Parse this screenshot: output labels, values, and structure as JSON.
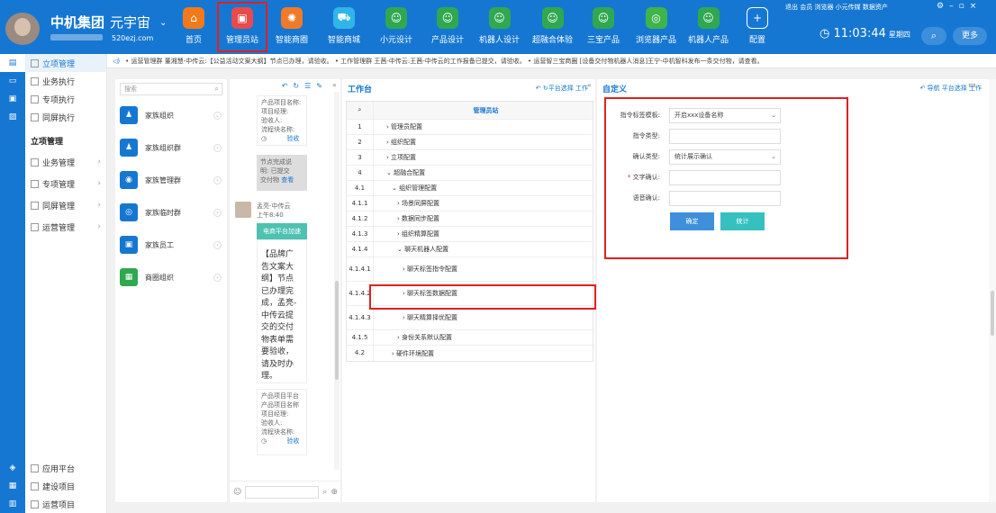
{
  "header": {
    "brand": "中机集团",
    "universe": "元宇宙",
    "url": "520ezj.com",
    "toplinks": "退出  会员  浏览器  小元传媒  数据资产",
    "time": "11:03:44",
    "weekday": "星期四",
    "more": "更多",
    "nav": [
      {
        "label": "首页",
        "icon": "home-icon",
        "color": "#f27a1a"
      },
      {
        "label": "管理员站",
        "icon": "admin-icon",
        "color": "#e84b4b"
      },
      {
        "label": "智能商圈",
        "icon": "gear-icon",
        "color": "#f07a2a"
      },
      {
        "label": "智能商城",
        "icon": "cart-icon",
        "color": "#2fb6e8"
      },
      {
        "label": "小元设计",
        "icon": "robot-icon",
        "color": "#2fa84f"
      },
      {
        "label": "产品设计",
        "icon": "robot-icon",
        "color": "#2fa84f"
      },
      {
        "label": "机器人设计",
        "icon": "robot-icon",
        "color": "#2fa84f"
      },
      {
        "label": "超融合体验",
        "icon": "robot-icon",
        "color": "#2fa84f"
      },
      {
        "label": "三宝产品",
        "icon": "robot-icon",
        "color": "#2fa84f"
      },
      {
        "label": "浏览器产品",
        "icon": "browser-icon",
        "color": "#3fb44a"
      },
      {
        "label": "机器人产品",
        "icon": "robot-icon",
        "color": "#2fa84f"
      },
      {
        "label": "配置",
        "icon": "plus-icon",
        "color": "#1677d2"
      }
    ]
  },
  "sidebar_icons": [
    "briefcase-icon",
    "monitor-icon",
    "card-icon",
    "image-icon"
  ],
  "bottom_icons": [
    "cube-icon",
    "box-icon",
    "doc-icon"
  ],
  "leftnav": {
    "top": [
      "立项管理",
      "业务执行",
      "专项执行",
      "同屏执行"
    ],
    "section": "立项管理",
    "sub": [
      "业务管理",
      "专项管理",
      "同屏管理",
      "运营管理"
    ],
    "bottom": [
      "应用平台",
      "建设项目",
      "运营项目"
    ]
  },
  "marquee": "• 运营管理群 董湘慧-中传云:【公益活动文案大纲】节点已办理，请验收。          • 工作管理群 王茜-中传云:王茜-中传云的工作报备已提交，请验收。          • 运营智三宝商圈 [设备交付物机器人消息]王宁-中机智科发布一条交付物，请查看。",
  "org": {
    "search": "搜索",
    "items": [
      "家族组织",
      "家族组织群",
      "家族管理群",
      "家族临时群",
      "家族员工",
      "商圈组织"
    ]
  },
  "chat": {
    "msg1": [
      "产品项目名称:",
      "项目经理:",
      "验收人:",
      "流程块名称:"
    ],
    "accept1": "验收",
    "gray": [
      "节点完成说",
      "明: 已提交",
      "交付物"
    ],
    "view": "查看",
    "sender": "孟亮-中传云",
    "sent_time": "上午8:40",
    "card_title": "电商平台加速",
    "card_body": [
      "【品牌广",
      "告文案大",
      "纲】节点",
      "已办理完",
      "成，孟亮-",
      "中传云提",
      "交的交付",
      "物表单需",
      "要验收，",
      "请及时办",
      "理。"
    ],
    "msg2": [
      "产品项目平台",
      "产品项目名称",
      "项目经理:",
      "验收人:",
      "流程块名称:"
    ],
    "accept2": "验收"
  },
  "work": {
    "title": "工作台",
    "tools": "平台选择  工作",
    "col_header": "管理员站",
    "rows": [
      {
        "num": "1",
        "label": "管理员配置"
      },
      {
        "num": "2",
        "label": "组织配置"
      },
      {
        "num": "3",
        "label": "立项配置"
      },
      {
        "num": "4",
        "label": "超融合配置"
      },
      {
        "num": "4.1",
        "label": "组织管理配置"
      },
      {
        "num": "4.1.1",
        "label": "场景同屏配置"
      },
      {
        "num": "4.1.2",
        "label": "数据同步配置"
      },
      {
        "num": "4.1.3",
        "label": "组织精算配置"
      },
      {
        "num": "4.1.4",
        "label": "聊天机器人配置"
      },
      {
        "num": "4.1.4.1",
        "label": "聊天标签指令配置"
      },
      {
        "num": "4.1.4.2",
        "label": "聊天标签数据配置"
      },
      {
        "num": "4.1.4.3",
        "label": "聊天精算择优配置"
      },
      {
        "num": "4.1.5",
        "label": "身份关系默认配置"
      },
      {
        "num": "4.2",
        "label": "硬件环境配置"
      }
    ]
  },
  "custom": {
    "title": "自定义",
    "tools": "导航  平台选择  工作",
    "fields": [
      {
        "label": "指令标签模板:",
        "value": "开启xxx设备名称",
        "dropdown": true,
        "required": false
      },
      {
        "label": "指令类型:",
        "value": "",
        "dropdown": false,
        "required": false
      },
      {
        "label": "确认类型:",
        "value": "统计展示确认",
        "dropdown": true,
        "required": false
      },
      {
        "label": "文字确认:",
        "value": "",
        "dropdown": false,
        "required": true
      },
      {
        "label": "语音确认:",
        "value": "",
        "dropdown": false,
        "required": false
      }
    ],
    "confirm": "确定",
    "stats": "统计"
  }
}
